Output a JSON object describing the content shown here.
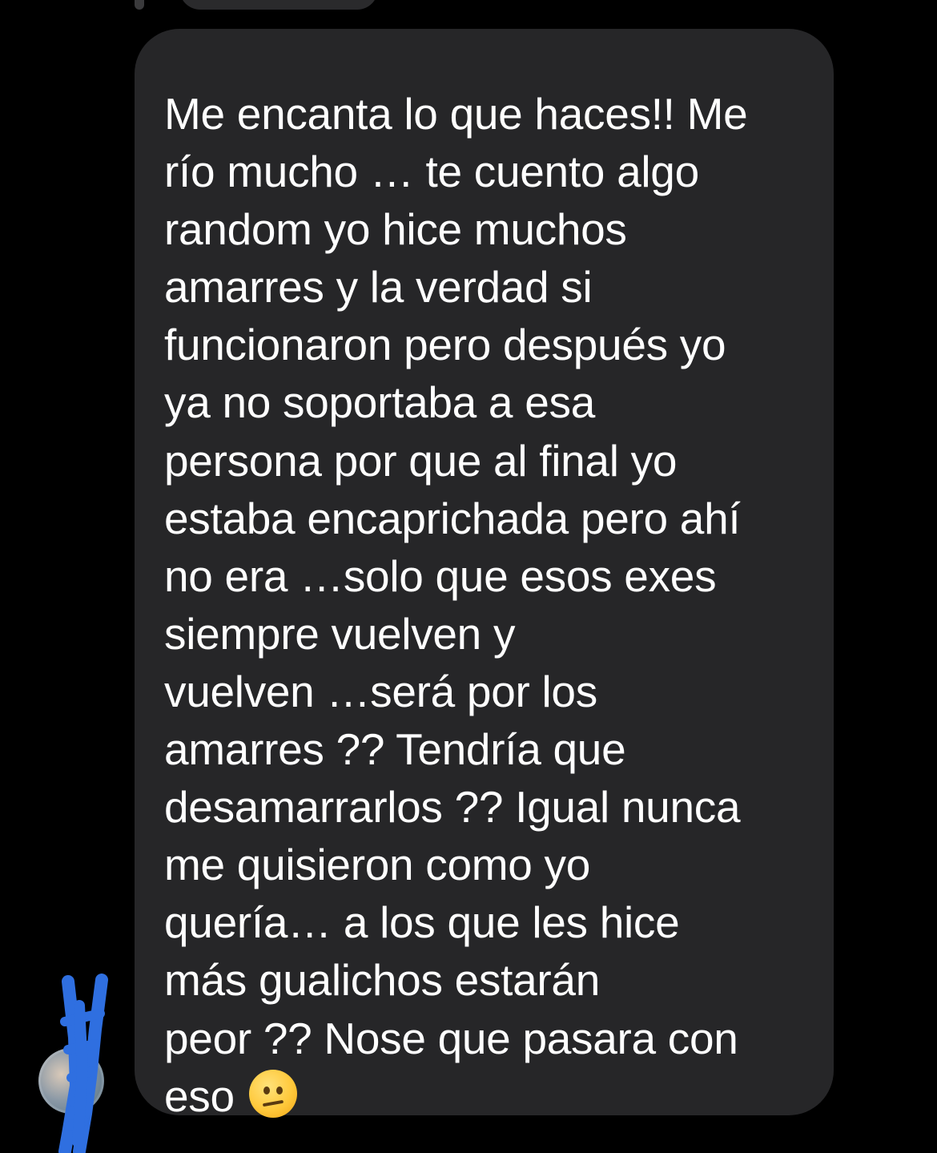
{
  "conversation": {
    "message": {
      "lines": [
        "Me encanta lo que haces!! Me",
        "río mucho … te cuento algo",
        "random yo hice muchos",
        "amarres y la verdad si",
        "funcionaron pero después yo",
        "ya no soportaba a esa",
        "persona por que  al final yo",
        "estaba encaprichada pero ahí",
        "no era …solo que esos exes",
        "siempre vuelven y",
        "vuelven …será por los",
        "amarres ?? Tendría que",
        "desamarrarlos ?? Igual nunca",
        "me quisieron como yo",
        "quería… a los que les hice",
        "más gualichos estarán",
        "peor ?? Nose que pasara con",
        "eso"
      ],
      "trailing_emoji": "confused-face-emoji"
    },
    "sender_avatar": "avatar-redacted"
  },
  "colors": {
    "background": "#000000",
    "bubble": "#262628",
    "text": "#ffffff",
    "redaction": "#2f6fe0"
  }
}
